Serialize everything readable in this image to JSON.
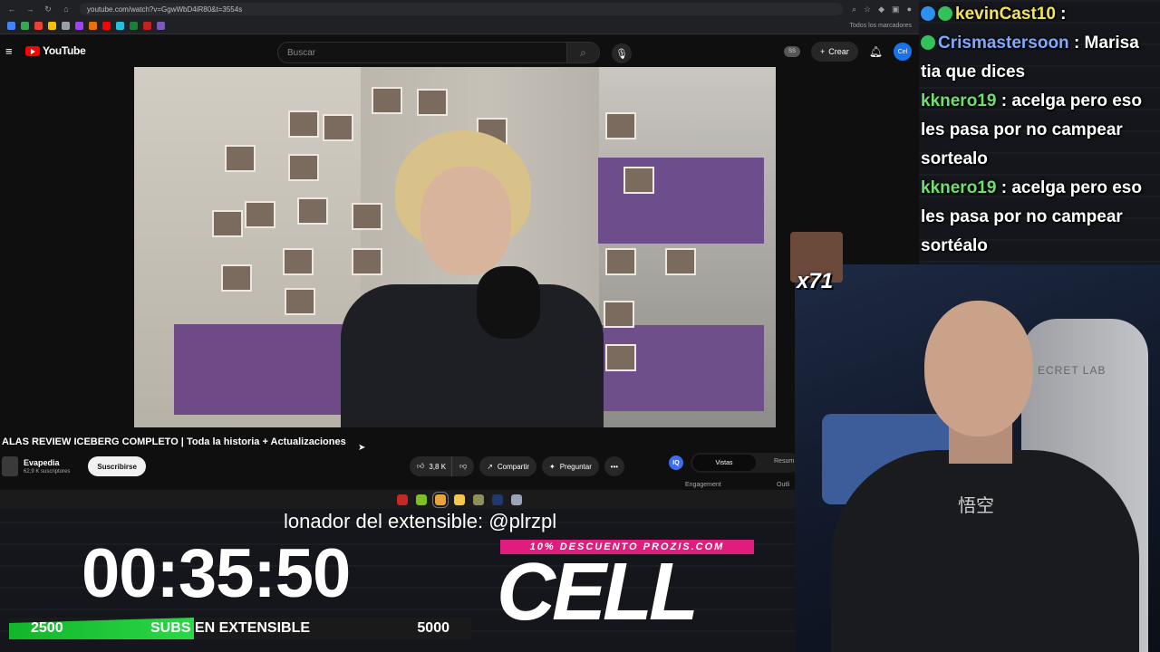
{
  "browser": {
    "url": "youtube.com/watch?v=GgwWbD4iR80&t=3554s",
    "bookmarks_folder": "Todos los marcadores"
  },
  "youtube": {
    "logo_text": "YouTube",
    "search_placeholder": "Buscar",
    "create_label": "Crear",
    "avatar_text": "Cel",
    "ss_badge": "SS",
    "video_title": "ALAS REVIEW ICEBERG COMPLETO | Toda la historia + Actualizaciones",
    "channel_name": "Evapedia",
    "channel_subs": "62,9 K suscriptores",
    "subscribe_label": "Suscribirse",
    "like_count": "3,8 K",
    "share_label": "Compartir",
    "ask_label": "Preguntar",
    "more_label": "•••"
  },
  "side_panel": {
    "logo_text": "IQ",
    "tab_active": "Vistas",
    "tab_other": "Resum",
    "label_left": "Engagement",
    "label_right": "Outli"
  },
  "chat": {
    "messages": [
      {
        "user": "kevinCast10",
        "sep": " :",
        "text": " ",
        "user_color": "#f2e35a"
      },
      {
        "user": "Crismastersoon",
        "sep": " :",
        "text": " Marisa tia que dices",
        "user_color": "#7fa8ff"
      },
      {
        "user": "kknero19",
        "sep": " :",
        "text": " acelga pero eso les pasa por no campear sortealo",
        "user_color": "#6ee06e"
      },
      {
        "user": "kknero19",
        "sep": " :",
        "text": " acelga pero eso les pasa por no campear sortéalo",
        "user_color": "#6ee06e"
      }
    ]
  },
  "emote": {
    "count": "x71"
  },
  "webcam": {
    "chair_text": "ECRET LAB",
    "shirt_print": "悟空"
  },
  "overlay": {
    "ticker_text": "lonador del extensible: @plrzpl",
    "timer": "00:35:50",
    "progress": {
      "left_label": "2500",
      "mid_label": "SUBS EN EXTENSIBLE",
      "right_label": "5000",
      "fill_fraction": 0.4
    },
    "promo_text": "10% DESCUENTO PROZIS.COM",
    "brand_text": "CELL"
  },
  "colors": {
    "accent_red": "#ff0000",
    "progress_green": "#2bd748",
    "promo_pink": "#e01d7c"
  }
}
